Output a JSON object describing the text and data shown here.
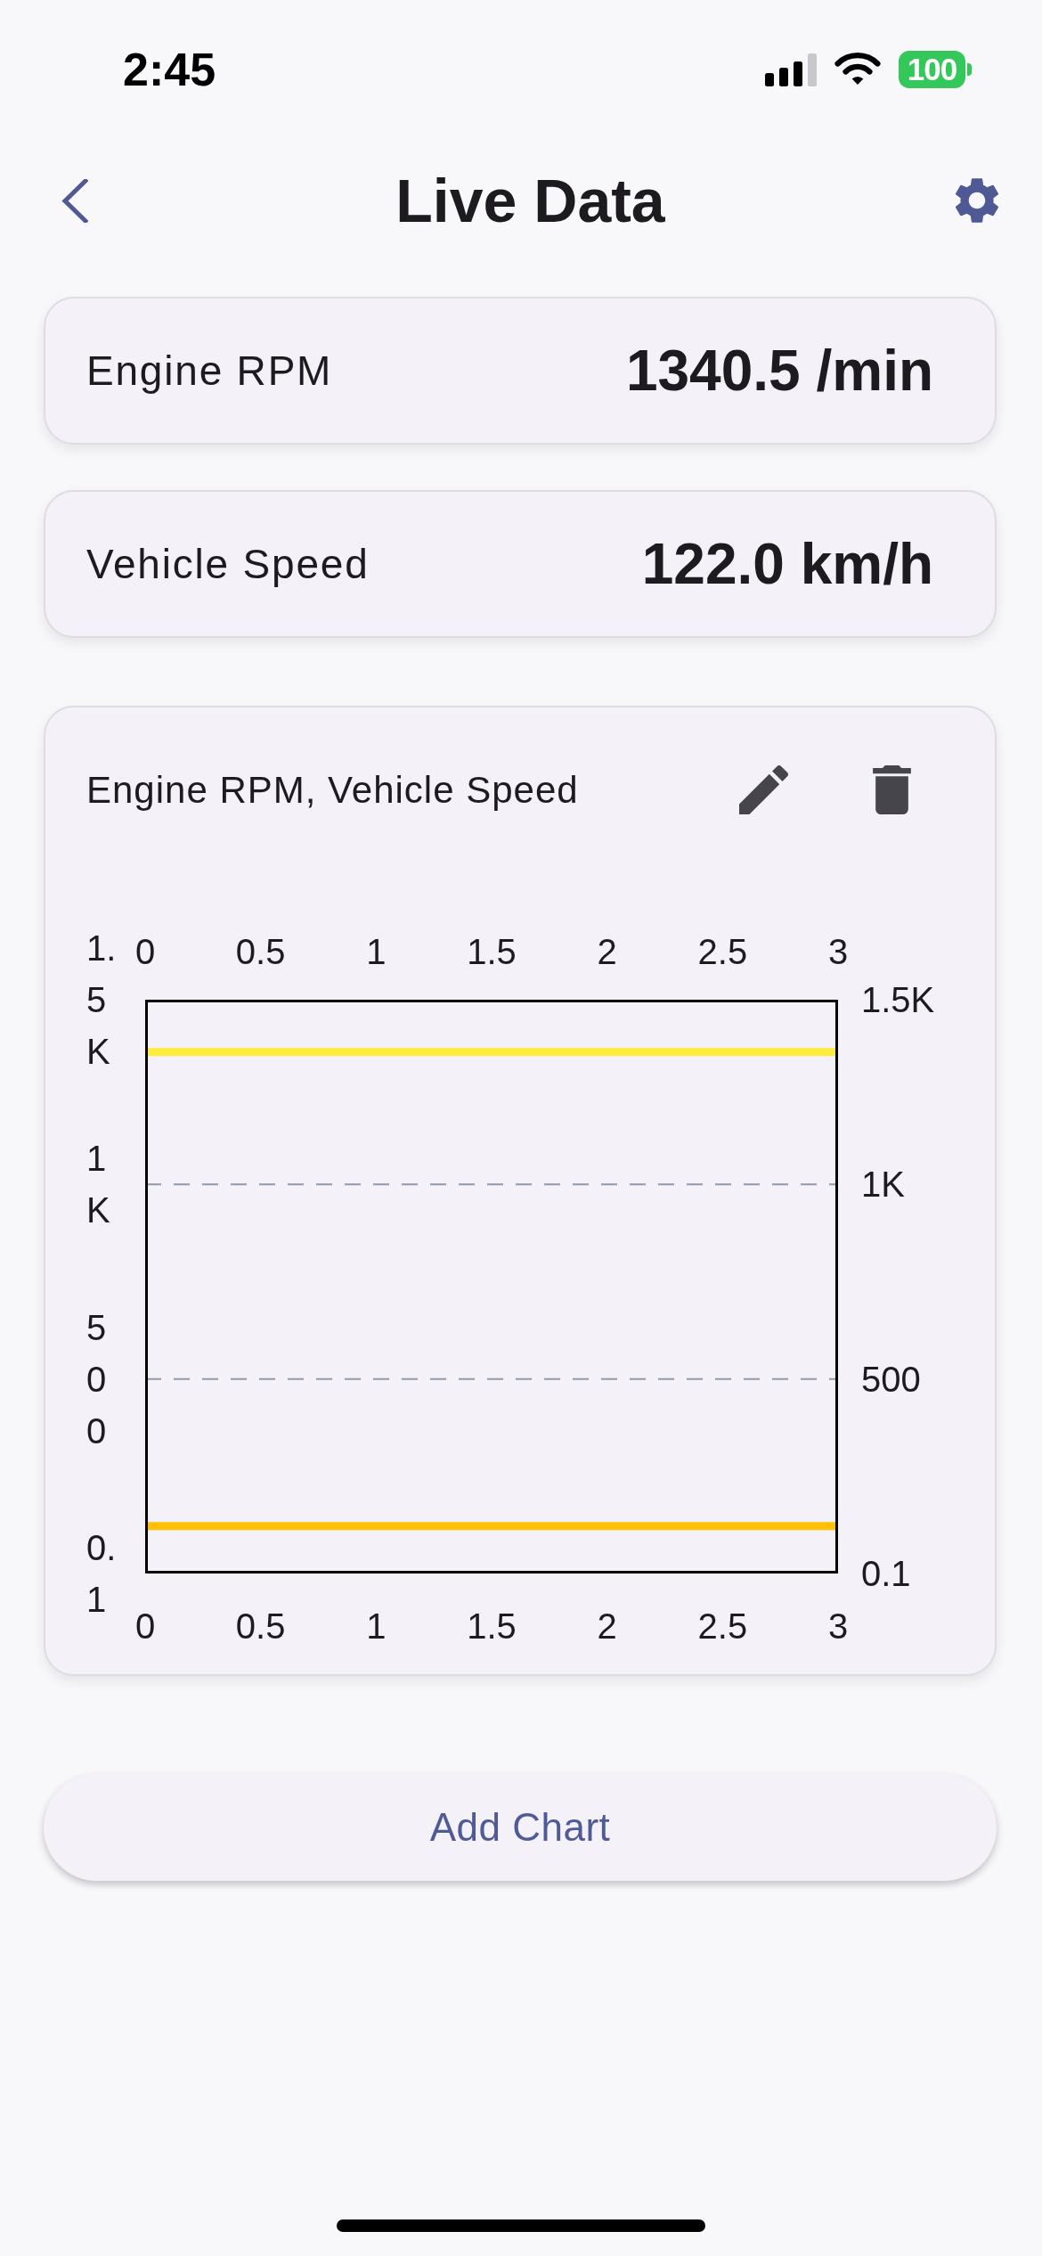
{
  "status_bar": {
    "time": "2:45",
    "battery": "100"
  },
  "nav": {
    "title": "Live Data"
  },
  "readings": [
    {
      "label": "Engine RPM",
      "value": "1340.5 /min"
    },
    {
      "label": "Vehicle Speed",
      "value": "122.0 km/h"
    }
  ],
  "chart_card": {
    "title": "Engine RPM, Vehicle Speed",
    "chart_data": {
      "type": "line",
      "x": [
        0,
        3
      ],
      "series": [
        {
          "color": "#ffeb3b",
          "values": [
            1340,
            1340
          ]
        },
        {
          "color": "#ffc107",
          "values": [
            122,
            122
          ]
        }
      ],
      "xlim": [
        0,
        3
      ],
      "ylim": [
        0.1,
        1474.55
      ],
      "xticks": [
        0,
        0.5,
        1,
        1.5,
        2,
        2.5,
        3
      ],
      "yticks": [
        {
          "value": 0.1,
          "label": "0.1"
        },
        {
          "value": 500,
          "label": "500"
        },
        {
          "value": 1000,
          "label": "1K"
        },
        {
          "value": 1474.55,
          "label": "1.5K"
        }
      ]
    },
    "left_axis_labels": [
      "1.5K",
      "1K",
      "500",
      "0.1"
    ],
    "bottom_axis_labels": [
      "0",
      "0.5",
      "1",
      "1.5",
      "2",
      "2.5",
      "3"
    ]
  },
  "add_button": {
    "label": "Add Chart"
  }
}
